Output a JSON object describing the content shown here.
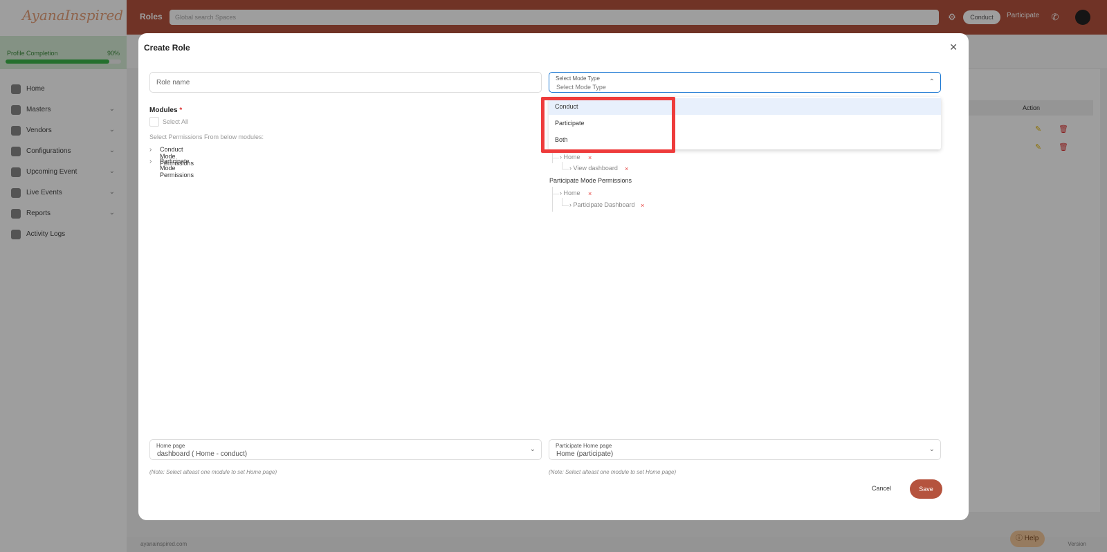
{
  "app": {
    "brand": "AyanaInspired",
    "topbar_title": "Roles",
    "search_placeholder": "Global search Spaces",
    "pill_label": "Conduct",
    "participate_link": "Participate"
  },
  "sidebar": {
    "profile_label": "Profile Completion",
    "profile_percent": "90%",
    "profile_progress": 0.9,
    "items": [
      {
        "label": "Home",
        "has_chevron": false
      },
      {
        "label": "Masters",
        "has_chevron": true
      },
      {
        "label": "Vendors",
        "has_chevron": true
      },
      {
        "label": "Configurations",
        "has_chevron": true
      },
      {
        "label": "Upcoming Event",
        "has_chevron": true
      },
      {
        "label": "Live Events",
        "has_chevron": true
      },
      {
        "label": "Reports",
        "has_chevron": true
      },
      {
        "label": "Activity Logs",
        "has_chevron": false
      }
    ]
  },
  "background": {
    "action_header": "Action",
    "footer_left": "ayanainspired.com",
    "footer_right": "Version",
    "help_label": "Help"
  },
  "modal": {
    "title": "Create Role",
    "role_name_placeholder": "Role name",
    "mode_type": {
      "label": "Select Mode Type",
      "value": "Select Mode Type",
      "options": [
        {
          "label": "Conduct",
          "active": true
        },
        {
          "label": "Participate",
          "active": false
        },
        {
          "label": "Both",
          "active": false
        }
      ]
    },
    "modules": {
      "label": "Modules",
      "required_mark": "*",
      "select_all": "Select All",
      "helper": "Select Permissions From below modules:",
      "groups": [
        "Conduct Mode Permissions",
        "Participate Mode Permissions"
      ]
    },
    "selected_tree": {
      "conduct": {
        "home": "Home",
        "child": "View dashboard"
      },
      "participate_heading": "Participate Mode Permissions",
      "participate": {
        "home": "Home",
        "child": "Participate Dashboard"
      },
      "remove_symbol": "×"
    },
    "home_page": {
      "label": "Home page",
      "value": "dashboard ( Home - conduct)"
    },
    "participate_home_page": {
      "label": "Participate Home page",
      "value": "Home (participate)"
    },
    "note": "(Note: Select alteast one module to set Home page)",
    "cancel_label": "Cancel",
    "save_label": "Save"
  },
  "icons": {
    "close": "close-icon",
    "chevron_down": "chevron-down-icon",
    "chevron_up": "chevron-up-icon",
    "chevron_right": "chevron-right-icon"
  },
  "colors": {
    "brand": "#b5533e",
    "focus": "#1976d2",
    "highlight": "#ee3b3b",
    "remove": "#e53935"
  }
}
